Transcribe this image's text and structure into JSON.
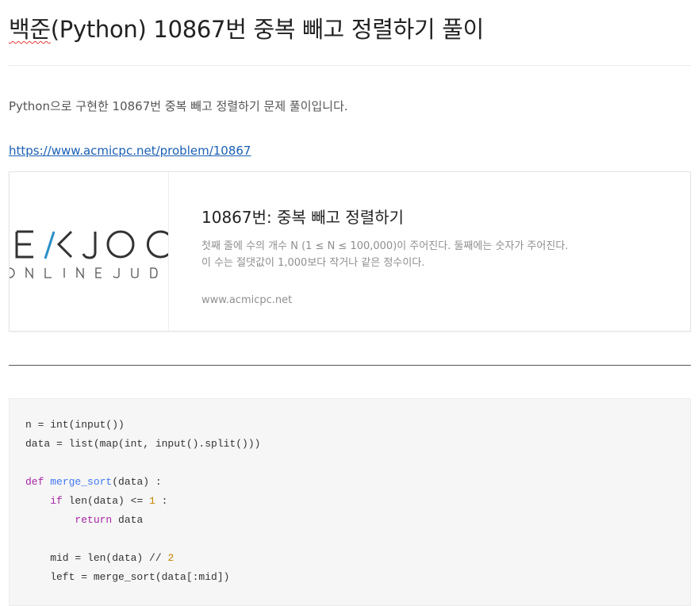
{
  "post": {
    "title_spell": "백준",
    "title_rest": "(Python) 10867번 중복 빼고 정렬하기 풀이",
    "intro": "Python으로 구현한 10867번 중복 빼고 정렬하기 문제 풀이입니다.",
    "link": "https://www.acmicpc.net/problem/10867"
  },
  "card": {
    "logo_text": "BAEKJOON",
    "logo_subtext": "ONLINE JUDGE",
    "title": "10867번: 중복 빼고 정렬하기",
    "description": "첫째 줄에 수의 개수 N (1 ≤ N ≤ 100,000)이 주어진다. 둘째에는 숫자가 주어진다. 이 수는 절댓값이 1,000보다 작거나 같은 정수이다.",
    "domain": "www.acmicpc.net"
  },
  "code": {
    "lines": [
      [
        {
          "t": "n = int(input())"
        }
      ],
      [
        {
          "t": "data = list(map(int, input().split()))"
        }
      ],
      [],
      [
        {
          "t": "def",
          "c": "kw"
        },
        {
          "t": " "
        },
        {
          "t": "merge_sort",
          "c": "fn"
        },
        {
          "t": "(data) :"
        }
      ],
      [
        {
          "t": "    "
        },
        {
          "t": "if",
          "c": "kw"
        },
        {
          "t": " len(data) <= "
        },
        {
          "t": "1",
          "c": "num"
        },
        {
          "t": " :"
        }
      ],
      [
        {
          "t": "        "
        },
        {
          "t": "return",
          "c": "kw"
        },
        {
          "t": " data"
        }
      ],
      [],
      [
        {
          "t": "    mid = len(data) // "
        },
        {
          "t": "2",
          "c": "num"
        }
      ],
      [
        {
          "t": "    left = merge_sort(data[:mid])"
        }
      ]
    ]
  }
}
